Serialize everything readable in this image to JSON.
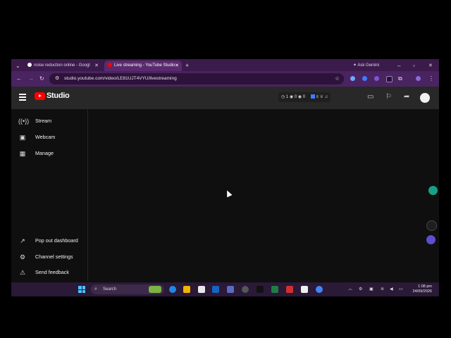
{
  "browser": {
    "tabs": [
      {
        "title": "noise reduction online - Googl",
        "active": false
      },
      {
        "title": "Live streaming - YouTube Studio",
        "active": true
      }
    ],
    "new_tab_glyph": "+",
    "profile_pill": "Ask Gemini",
    "url": "studio.youtube.com/video/LE81UJT4VYU/livestreaming",
    "window_controls": {
      "minimize": "–",
      "restore": "▫",
      "close": "✕"
    },
    "accent": "#4a2361"
  },
  "studio": {
    "logo_text": "Studio",
    "stats": {
      "comments": "1",
      "views1": "0",
      "views2": "0"
    },
    "sidebar_top": [
      {
        "label": "Stream",
        "icon": "broadcast-icon"
      },
      {
        "label": "Webcam",
        "icon": "webcam-icon"
      },
      {
        "label": "Manage",
        "icon": "calendar-icon"
      }
    ],
    "sidebar_bottom": [
      {
        "label": "Pop out dashboard",
        "icon": "arrow-out-icon"
      },
      {
        "label": "Channel settings",
        "icon": "gear-icon"
      },
      {
        "label": "Send feedback",
        "icon": "feedback-icon"
      }
    ]
  },
  "taskbar": {
    "search_placeholder": "Search",
    "time": "1:08 pm",
    "date": "24/09/2026"
  }
}
